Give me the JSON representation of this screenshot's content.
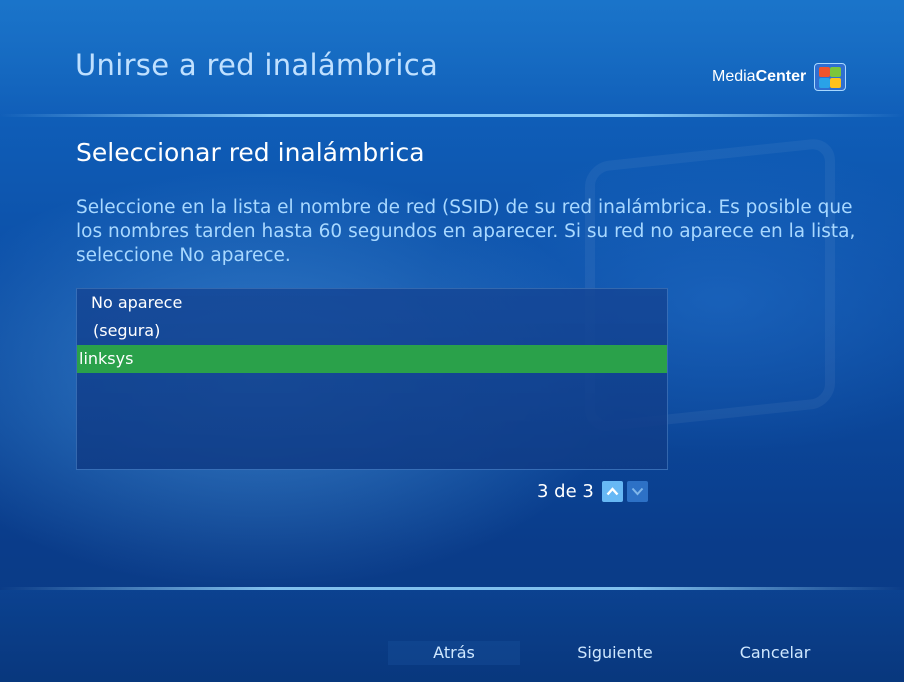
{
  "header": {
    "title": "Unirse a red inalámbrica",
    "logo": {
      "media": "Media",
      "center": "Center",
      "icon": "windows-flag-icon"
    }
  },
  "main": {
    "section_title": "Seleccionar red inalámbrica",
    "description": "Seleccione en la lista el nombre de red (SSID) de su red inalámbrica. Es posible que los nombres tarden hasta 60 segundos en aparecer. Si su red no aparece en la lista, seleccione No aparece.",
    "networks": [
      {
        "label": "No aparece"
      },
      {
        "label": "(segura)"
      },
      {
        "label": "linksys"
      }
    ],
    "selected_index": 2,
    "pager": {
      "text": "3 de 3",
      "up_icon": "chevron-up-icon",
      "down_icon": "chevron-down-icon"
    }
  },
  "footer": {
    "back_label": "Atrás",
    "next_label": "Siguiente",
    "cancel_label": "Cancelar"
  },
  "colors": {
    "background": "#0c4fa7",
    "title": "#bfe0ff",
    "description": "#a8d8ff",
    "selection": "#2aa14a"
  }
}
